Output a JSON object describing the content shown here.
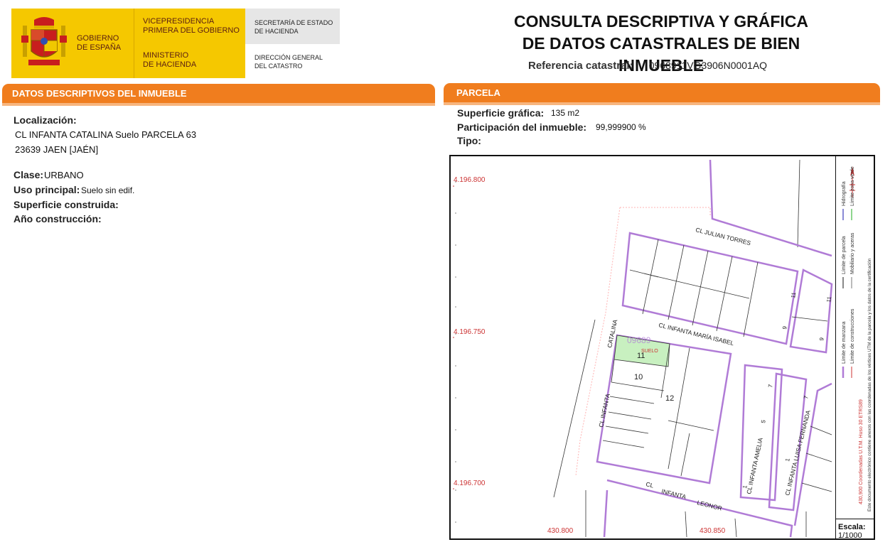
{
  "header": {
    "gobierno": "GOBIERNO\nDE ESPAÑA",
    "vicepresidencia": "VICEPRESIDENCIA\nPRIMERA DEL GOBIERNO",
    "ministerio": "MINISTERIO\nDE HACIENDA",
    "secretaria": "SECRETARÍA DE ESTADO\nDE HACIENDA",
    "direccion": "DIRECCIÓN GENERAL\nDEL CATASTRO",
    "title": "CONSULTA DESCRIPTIVA Y GRÁFICA\nDE DATOS CATASTRALES DE BIEN INMUEBLE",
    "ref_label": "Referencia catastral:",
    "ref_value": "0968911VG3906N0001AQ"
  },
  "descriptive": {
    "section_title": "DATOS DESCRIPTIVOS DEL INMUEBLE",
    "localizacion_label": "Localización:",
    "localizacion_line1": "CL INFANTA CATALINA  Suelo PARCELA 63",
    "localizacion_line2": "23639 JAEN [JAÉN]",
    "clase_label": "Clase:",
    "clase_value": "URBANO",
    "uso_label": "Uso principal:",
    "uso_value": "Suelo sin edif.",
    "superficie_label": "Superficie construida:",
    "anio_label": "Año construcción:"
  },
  "parcela": {
    "section_title": "PARCELA",
    "superficie_label": "Superficie gráfica:",
    "superficie_value": "135 m2",
    "participacion_label": "Participación del inmueble:",
    "participacion_value": "99,999900 %",
    "tipo_label": "Tipo:"
  },
  "map": {
    "y_coords": [
      "4.196.800",
      "4.196.750",
      "4.196.700"
    ],
    "x_coords": [
      "430.800",
      "430.850"
    ],
    "streets": {
      "julian_torres": "CL  JULIAN  TORRES",
      "maria_isabel": "CL  INFANTA  MARÍA  ISABEL",
      "catalina": "CATALINA",
      "infanta_left": "CL   INFANTA",
      "leonor_cl": "CL",
      "leonor_infanta": "INFANTA",
      "leonor": "LEONOR",
      "amelia": "CL  INFANTA  AMELIA",
      "luisa": "CL  INFANTA  LUISA  FERNANDA"
    },
    "parcel_ghost": "09689",
    "parcel_suelo": "SUELO",
    "numbers": {
      "n11": "11",
      "n10": "10",
      "n12": "12",
      "n9a": "9",
      "n11b": "11",
      "n9b": "9",
      "n11c": "11",
      "n7a": "7",
      "n5": "5",
      "n7b": "7",
      "n1": "1",
      "n1b": "1"
    },
    "colors": {
      "manzana": "#b07bd6",
      "construcciones": "#333333",
      "subject_parcel": "#c8f0c0",
      "coords": "#cc3333",
      "limite_zona": "#ffb3b3"
    },
    "legend": {
      "limite_manzana": "Límite de manzana",
      "limite_parcela": "Límite de parcela",
      "hidrografia": "Hidrografía",
      "limite_construcciones": "Límite de construcciones",
      "mobiliario": "Mobiliario y aceras",
      "zona_verde": "Límite zona verde",
      "coord_note": "430,900 Coordenadas U.T.M. Huso 30 ETRS89",
      "document_note": "Este documento electrónico contiene anexos con las coordenadas de los vértices UTM de la parcela y los datos de la certificación"
    },
    "scale_label": "Escala:",
    "scale_value": "1/1000"
  }
}
